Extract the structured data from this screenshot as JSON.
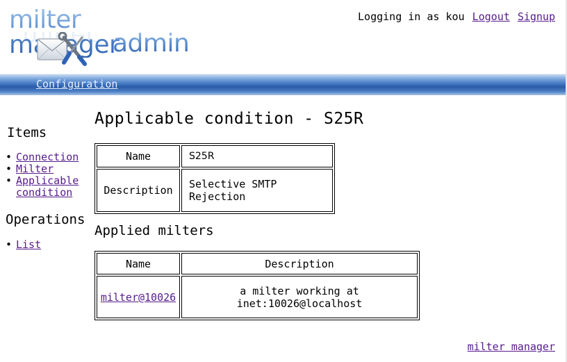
{
  "header": {
    "logo": {
      "line1": "milter manager",
      "line2": "admin"
    },
    "login_text": "Logging in as kou",
    "logout_label": "Logout",
    "signup_label": "Signup"
  },
  "nav": {
    "configuration_label": "Configuration"
  },
  "sidebar": {
    "items_heading": "Items",
    "items": [
      {
        "label": "Connection"
      },
      {
        "label": "Milter"
      },
      {
        "label": "Applicable condition"
      }
    ],
    "operations_heading": "Operations",
    "operations": [
      {
        "label": "List"
      }
    ]
  },
  "main": {
    "title": "Applicable condition - S25R",
    "details": {
      "name_header": "Name",
      "name_value": "S25R",
      "description_header": "Description",
      "description_value": "Selective SMTP Rejection"
    },
    "applied_heading": "Applied milters",
    "milters_table": {
      "columns": [
        "Name",
        "Description"
      ],
      "rows": [
        {
          "name": "milter@10026",
          "description": "a milter working at inet:10026@localhost"
        }
      ]
    }
  },
  "footer": {
    "link_label": "milter manager"
  },
  "colors": {
    "link": "#551a8b",
    "nav_blue": "#2a5ba6",
    "logo_blue": "#4a7cc4"
  }
}
